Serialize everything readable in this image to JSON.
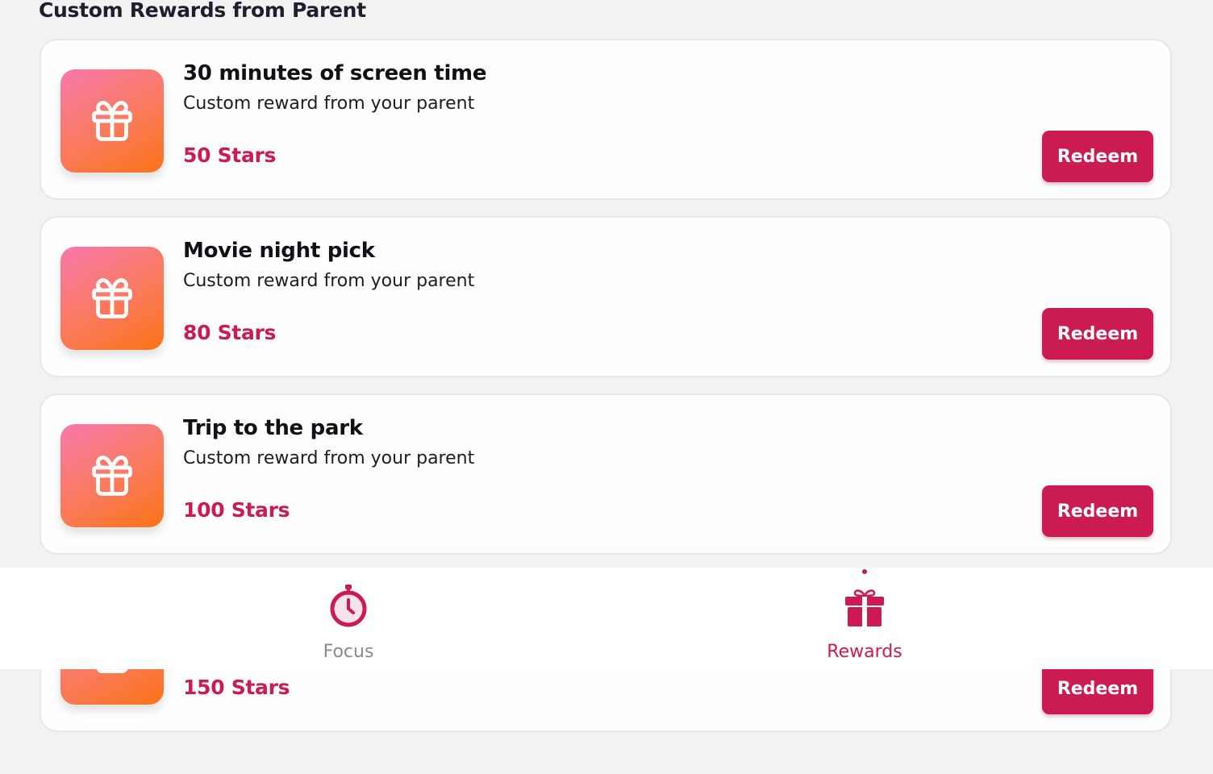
{
  "section": {
    "title": "Custom Rewards from Parent"
  },
  "rewards": [
    {
      "title": "30 minutes of screen time",
      "subtitle": "Custom reward from your parent",
      "cost": "50 Stars",
      "button": "Redeem"
    },
    {
      "title": "Movie night pick",
      "subtitle": "Custom reward from your parent",
      "cost": "80 Stars",
      "button": "Redeem"
    },
    {
      "title": "Trip to the park",
      "subtitle": "Custom reward from your parent",
      "cost": "100 Stars",
      "button": "Redeem"
    },
    {
      "title": "",
      "subtitle": "",
      "cost": "150 Stars",
      "button": "Redeem"
    }
  ],
  "nav": {
    "items": [
      {
        "label": "Focus",
        "icon": "stopwatch-icon",
        "active": false
      },
      {
        "label": "Rewards",
        "icon": "gift-icon",
        "active": true
      }
    ]
  },
  "colors": {
    "accent": "#cc1a52",
    "background": "#f2f2f2",
    "card": "#fefefe",
    "inactive_nav": "#8a8a8e",
    "tile_gradient": [
      "#f779ac",
      "#fa7a60",
      "#fb7417"
    ]
  }
}
